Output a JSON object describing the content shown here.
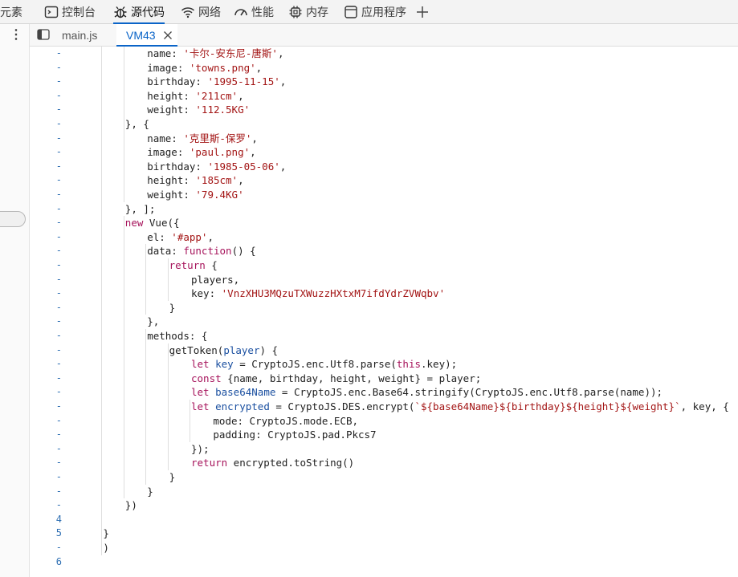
{
  "toolbar": {
    "tabs": [
      {
        "label": "元素",
        "icon": "none"
      },
      {
        "label": "控制台",
        "icon": "console-icon"
      },
      {
        "label": "源代码",
        "icon": "bug-icon"
      },
      {
        "label": "网络",
        "icon": "wifi-icon"
      },
      {
        "label": "性能",
        "icon": "gauge-icon"
      },
      {
        "label": "内存",
        "icon": "chip-icon"
      },
      {
        "label": "应用程序",
        "icon": "window-icon"
      }
    ],
    "add_icon": "plus-icon",
    "active_index": 2
  },
  "file_tabs": [
    {
      "label": "main.js"
    },
    {
      "label": "VM43"
    }
  ],
  "colors": {
    "accent": "#0a64c8",
    "keyword": "#a6135b",
    "string": "#a31515",
    "variable": "#1a4fa0"
  },
  "code_lines": [
    {
      "g": "-",
      "indent": 12,
      "parts": [
        [
          "t",
          "name: "
        ],
        [
          "s",
          "'卡尔-安东尼-唐斯'"
        ],
        [
          "t",
          ","
        ]
      ]
    },
    {
      "g": "-",
      "indent": 12,
      "parts": [
        [
          "t",
          "image: "
        ],
        [
          "s",
          "'towns.png'"
        ],
        [
          "t",
          ","
        ]
      ]
    },
    {
      "g": "-",
      "indent": 12,
      "parts": [
        [
          "t",
          "birthday: "
        ],
        [
          "s",
          "'1995-11-15'"
        ],
        [
          "t",
          ","
        ]
      ]
    },
    {
      "g": "-",
      "indent": 12,
      "parts": [
        [
          "t",
          "height: "
        ],
        [
          "s",
          "'211cm'"
        ],
        [
          "t",
          ","
        ]
      ]
    },
    {
      "g": "-",
      "indent": 12,
      "parts": [
        [
          "t",
          "weight: "
        ],
        [
          "s",
          "'112.5KG'"
        ]
      ]
    },
    {
      "g": "-",
      "indent": 8,
      "parts": [
        [
          "t",
          "}, {"
        ]
      ]
    },
    {
      "g": "-",
      "indent": 12,
      "parts": [
        [
          "t",
          "name: "
        ],
        [
          "s",
          "'克里斯-保罗'"
        ],
        [
          "t",
          ","
        ]
      ]
    },
    {
      "g": "-",
      "indent": 12,
      "parts": [
        [
          "t",
          "image: "
        ],
        [
          "s",
          "'paul.png'"
        ],
        [
          "t",
          ","
        ]
      ]
    },
    {
      "g": "-",
      "indent": 12,
      "parts": [
        [
          "t",
          "birthday: "
        ],
        [
          "s",
          "'1985-05-06'"
        ],
        [
          "t",
          ","
        ]
      ]
    },
    {
      "g": "-",
      "indent": 12,
      "parts": [
        [
          "t",
          "height: "
        ],
        [
          "s",
          "'185cm'"
        ],
        [
          "t",
          ","
        ]
      ]
    },
    {
      "g": "-",
      "indent": 12,
      "parts": [
        [
          "t",
          "weight: "
        ],
        [
          "s",
          "'79.4KG'"
        ]
      ]
    },
    {
      "g": "-",
      "indent": 8,
      "parts": [
        [
          "t",
          "}, ];"
        ]
      ]
    },
    {
      "g": "-",
      "indent": 8,
      "parts": [
        [
          "k",
          "new"
        ],
        [
          "t",
          " Vue({"
        ]
      ]
    },
    {
      "g": "-",
      "indent": 12,
      "parts": [
        [
          "t",
          "el: "
        ],
        [
          "s",
          "'#app'"
        ],
        [
          "t",
          ","
        ]
      ]
    },
    {
      "g": "-",
      "indent": 12,
      "parts": [
        [
          "t",
          "data: "
        ],
        [
          "k",
          "function"
        ],
        [
          "t",
          "() {"
        ]
      ]
    },
    {
      "g": "-",
      "indent": 16,
      "parts": [
        [
          "k",
          "return"
        ],
        [
          "t",
          " {"
        ]
      ]
    },
    {
      "g": "-",
      "indent": 20,
      "parts": [
        [
          "t",
          "players,"
        ]
      ]
    },
    {
      "g": "-",
      "indent": 20,
      "parts": [
        [
          "t",
          "key: "
        ],
        [
          "s",
          "'VnzXHU3MQzuTXWuzzHXtxM7ifdYdrZVWqbv'"
        ]
      ]
    },
    {
      "g": "-",
      "indent": 16,
      "parts": [
        [
          "t",
          "}"
        ]
      ]
    },
    {
      "g": "-",
      "indent": 12,
      "parts": [
        [
          "t",
          "},"
        ]
      ]
    },
    {
      "g": "-",
      "indent": 12,
      "parts": [
        [
          "t",
          "methods: {"
        ]
      ]
    },
    {
      "g": "-",
      "indent": 16,
      "parts": [
        [
          "t",
          "getToken("
        ],
        [
          "v",
          "player"
        ],
        [
          "t",
          ") {"
        ]
      ]
    },
    {
      "g": "-",
      "indent": 20,
      "parts": [
        [
          "k",
          "let"
        ],
        [
          "t",
          " "
        ],
        [
          "v",
          "key"
        ],
        [
          "t",
          " = CryptoJS.enc.Utf8.parse("
        ],
        [
          "k",
          "this"
        ],
        [
          "t",
          ".key);"
        ]
      ]
    },
    {
      "g": "-",
      "indent": 20,
      "parts": [
        [
          "k",
          "const"
        ],
        [
          "t",
          " {name, birthday, height, weight} = player;"
        ]
      ]
    },
    {
      "g": "-",
      "indent": 20,
      "parts": [
        [
          "k",
          "let"
        ],
        [
          "t",
          " "
        ],
        [
          "v",
          "base64Name"
        ],
        [
          "t",
          " = CryptoJS.enc.Base64.stringify(CryptoJS.enc.Utf8.parse(name));"
        ]
      ]
    },
    {
      "g": "-",
      "indent": 20,
      "parts": [
        [
          "k",
          "let"
        ],
        [
          "t",
          " "
        ],
        [
          "v",
          "encrypted"
        ],
        [
          "t",
          " = CryptoJS.DES.encrypt("
        ],
        [
          "s",
          "`${base64Name}${birthday}${height}${weight}`"
        ],
        [
          "t",
          ", key, {"
        ]
      ]
    },
    {
      "g": "-",
      "indent": 24,
      "parts": [
        [
          "t",
          "mode: CryptoJS.mode.ECB,"
        ]
      ]
    },
    {
      "g": "-",
      "indent": 24,
      "parts": [
        [
          "t",
          "padding: CryptoJS.pad.Pkcs7"
        ]
      ]
    },
    {
      "g": "-",
      "indent": 20,
      "parts": [
        [
          "t",
          "});"
        ]
      ]
    },
    {
      "g": "-",
      "indent": 20,
      "parts": [
        [
          "k",
          "return"
        ],
        [
          "t",
          " encrypted.toString()"
        ]
      ]
    },
    {
      "g": "-",
      "indent": 16,
      "parts": [
        [
          "t",
          "}"
        ]
      ]
    },
    {
      "g": "-",
      "indent": 12,
      "parts": [
        [
          "t",
          "}"
        ]
      ]
    },
    {
      "g": "-",
      "indent": 8,
      "parts": [
        [
          "t",
          "})"
        ]
      ]
    },
    {
      "g": "4",
      "indent": 0,
      "parts": []
    },
    {
      "g": "5",
      "indent": 4,
      "parts": [
        [
          "t",
          "}"
        ]
      ]
    },
    {
      "g": "-",
      "indent": 4,
      "parts": [
        [
          "t",
          ")"
        ]
      ]
    },
    {
      "g": "6",
      "indent": 0,
      "parts": []
    }
  ]
}
